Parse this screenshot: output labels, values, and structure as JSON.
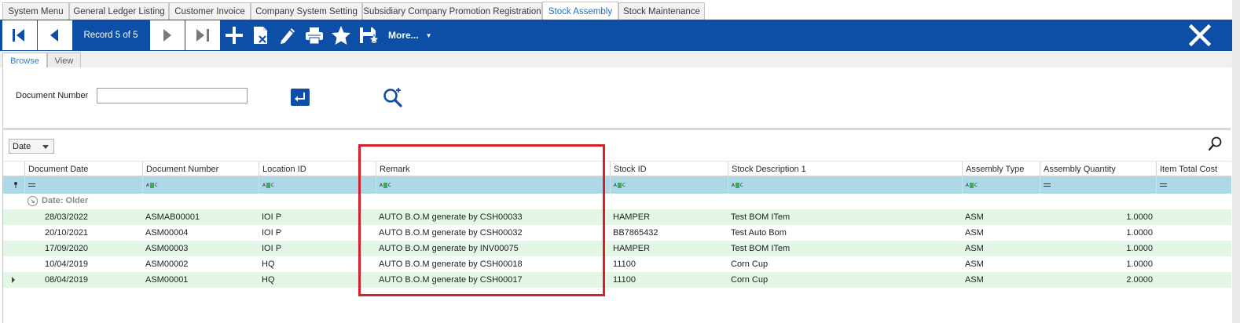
{
  "doc_tabs": [
    {
      "label": "System Menu",
      "active": false
    },
    {
      "label": "General Ledger Listing",
      "active": false
    },
    {
      "label": "Customer Invoice",
      "active": false
    },
    {
      "label": "Company System Setting",
      "active": false
    },
    {
      "label": "Subsidiary Company Promotion Registration",
      "active": false
    },
    {
      "label": "Stock Assembly",
      "active": true
    },
    {
      "label": "Stock Maintenance",
      "active": false
    }
  ],
  "toolbar": {
    "record_label": "Record 5 of 5",
    "more_label": "More...",
    "accent_color": "#0d4fa6",
    "icons": [
      "first-record-icon",
      "previous-record-icon",
      "next-record-icon",
      "last-record-icon",
      "plus-icon",
      "delete-document-icon",
      "pencil-icon",
      "printer-icon",
      "star-icon",
      "save-icon",
      "close-icon"
    ]
  },
  "view_tabs": [
    {
      "label": "Browse",
      "active": true
    },
    {
      "label": "View",
      "active": false
    }
  ],
  "search": {
    "document_number_label": "Document Number",
    "document_number_value": ""
  },
  "grid": {
    "group_by_value": "Date",
    "columns": [
      "Document Date",
      "Document Number",
      "Location ID",
      "Remark",
      "Stock ID",
      "Stock Description 1",
      "Assembly Type",
      "Assembly Quantity",
      "Item Total Cost"
    ],
    "filter_ops": [
      "=",
      "abc",
      "abc",
      "abc",
      "abc",
      "abc",
      "abc",
      "=",
      "="
    ],
    "group_label": "Date: Older",
    "rows": [
      {
        "date": "28/03/2022",
        "doc_no": "ASMAB00001",
        "location": "IOI P",
        "remark": "AUTO B.O.M generate by CSH00033",
        "stock_id": "HAMPER",
        "desc": "Test BOM ITem",
        "type": "ASM",
        "qty": "1.0000",
        "cost": ""
      },
      {
        "date": "20/10/2021",
        "doc_no": "ASM00004",
        "location": "IOI P",
        "remark": "AUTO B.O.M generate by CSH00032",
        "stock_id": "BB7865432",
        "desc": "Test Auto Bom",
        "type": "ASM",
        "qty": "1.0000",
        "cost": ""
      },
      {
        "date": "17/09/2020",
        "doc_no": "ASM00003",
        "location": "IOI P",
        "remark": "AUTO B.O.M generate by INV00075",
        "stock_id": "HAMPER",
        "desc": "Test BOM ITem",
        "type": "ASM",
        "qty": "1.0000",
        "cost": ""
      },
      {
        "date": "10/04/2019",
        "doc_no": "ASM00002",
        "location": "HQ",
        "remark": "AUTO B.O.M generate by CSH00018",
        "stock_id": "11100",
        "desc": "Corn Cup",
        "type": "ASM",
        "qty": "1.0000",
        "cost": ""
      },
      {
        "date": "08/04/2019",
        "doc_no": "ASM00001",
        "location": "HQ",
        "remark": "AUTO B.O.M generate by CSH00017",
        "stock_id": "11100",
        "desc": "Corn Cup",
        "type": "ASM",
        "qty": "2.0000",
        "cost": ""
      }
    ],
    "row_alt_color": "#e4f7e6",
    "filter_row_color": "#add8e6",
    "highlight_color": "#d81e2b"
  }
}
